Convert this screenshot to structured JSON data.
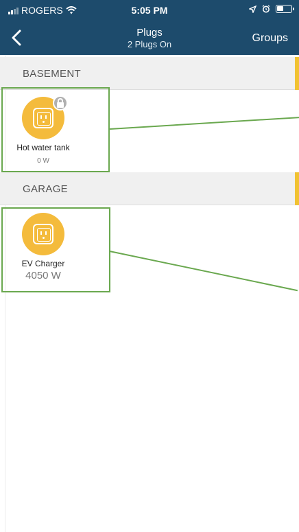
{
  "status_bar": {
    "carrier": "ROGERS",
    "time": "5:05 PM"
  },
  "nav": {
    "title": "Plugs",
    "subtitle": "2 Plugs On",
    "groups_label": "Groups"
  },
  "sections": [
    {
      "label": "BASEMENT",
      "plugs": [
        {
          "name": "Hot water tank",
          "power": "0 W",
          "locked": true
        }
      ]
    },
    {
      "label": "GARAGE",
      "plugs": [
        {
          "name": "EV Charger",
          "power": "4050 W",
          "locked": false
        }
      ]
    }
  ],
  "colors": {
    "header": "#1d4b6c",
    "plug_on": "#f4bb3c",
    "section_accent": "#f1c232",
    "highlight": "#6aa84f"
  }
}
